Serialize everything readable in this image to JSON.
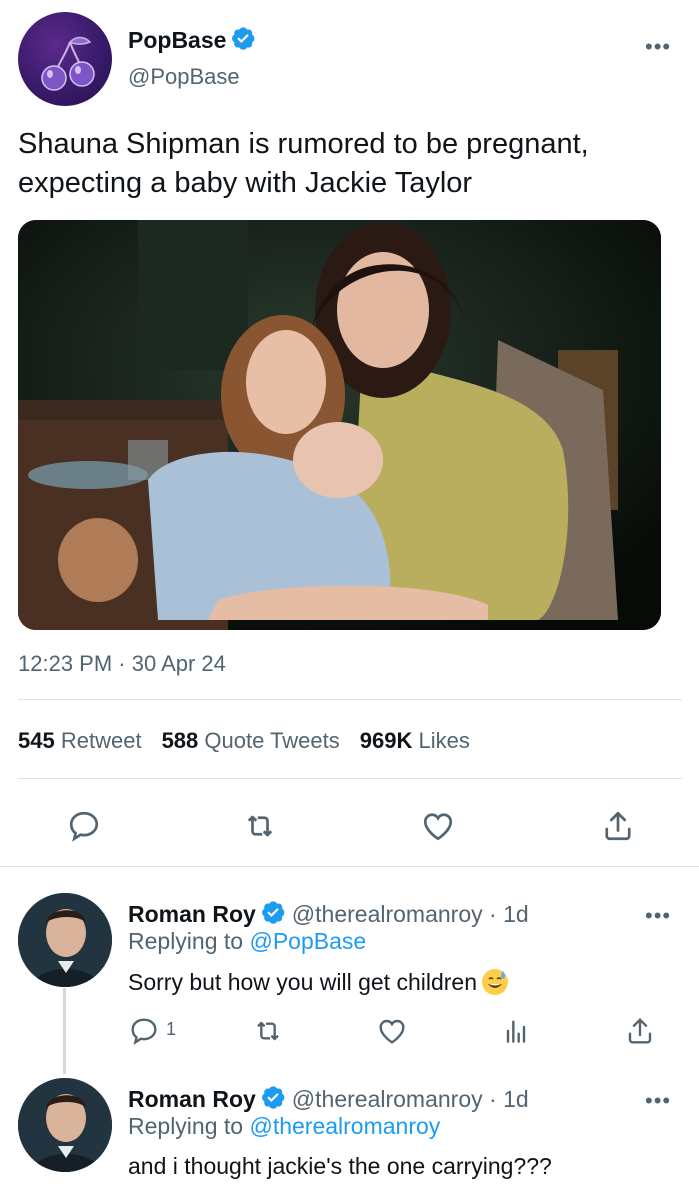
{
  "tweet": {
    "author_name": "PopBase",
    "author_handle": "@PopBase",
    "avatar_icon": "cherry-icon",
    "more_label": "•••",
    "text": "Shauna Shipman is rumored to be pregnant, expecting a baby with Jackie Taylor",
    "timestamp": "12:23 PM · 30 Apr 24",
    "stats": {
      "retweets_count": "545",
      "retweets_label": "Retweet",
      "quotes_count": "588",
      "quotes_label": "Quote Tweets",
      "likes_count": "969K",
      "likes_label": "Likes"
    },
    "actions": [
      "reply-icon",
      "retweet-icon",
      "like-icon",
      "share-icon"
    ]
  },
  "replies": [
    {
      "author_name": "Roman Roy",
      "author_handle": "@therealromanroy",
      "age": "· 1d",
      "replying_prefix": "Replying to",
      "replying_to": "@PopBase",
      "text": "Sorry but how you will get children",
      "emoji": "sweat-smile-emoji",
      "reply_count": "1",
      "more_label": "•••"
    },
    {
      "author_name": "Roman Roy",
      "author_handle": "@therealromanroy",
      "age": "· 1d",
      "replying_prefix": "Replying to",
      "replying_to": "@therealromanroy",
      "text": "and i thought jackie's the one carrying???",
      "more_label": "•••"
    }
  ],
  "colors": {
    "verified": "#1d9bf0",
    "link": "#1d9bf0",
    "secondary_text": "#536471",
    "primary_text": "#0f1419",
    "divider": "#dfe3e6"
  }
}
